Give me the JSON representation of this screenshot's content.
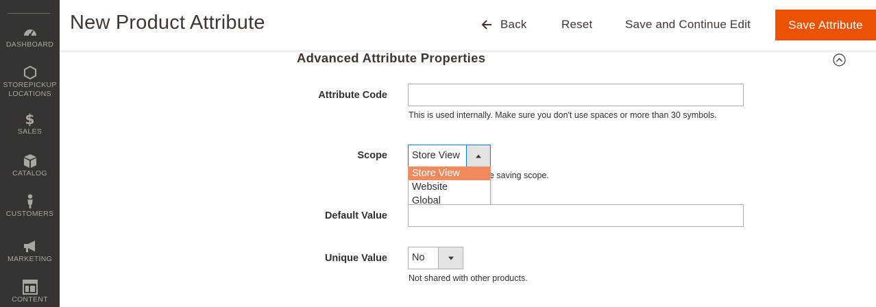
{
  "sidebar": {
    "items": [
      {
        "label": "DASHBOARD",
        "icon": "dashboard-icon"
      },
      {
        "label_line1": "STOREPICKUP",
        "label_line2": "LOCATIONS",
        "icon": "hexagon-icon"
      },
      {
        "label": "SALES",
        "icon": "dollar-icon",
        "glyph": "$"
      },
      {
        "label": "CATALOG",
        "icon": "catalog-box-icon"
      },
      {
        "label": "CUSTOMERS",
        "icon": "customer-person-icon"
      },
      {
        "label": "MARKETING",
        "icon": "megaphone-icon"
      },
      {
        "label": "CONTENT",
        "icon": "content-layout-icon"
      }
    ]
  },
  "header": {
    "title": "New Product Attribute",
    "back_label": "Back",
    "reset_label": "Reset",
    "save_continue_label": "Save and Continue Edit",
    "save_attribute_label": "Save Attribute"
  },
  "section": {
    "title": "Advanced Attribute Properties"
  },
  "fields": {
    "attribute_code": {
      "label": "Attribute Code",
      "value": "",
      "note": "This is used internally. Make sure you don't use spaces or more than 30 symbols."
    },
    "scope": {
      "label": "Scope",
      "value": "Store View",
      "note_visible": "e saving scope.",
      "options": [
        "Store View",
        "Website",
        "Global"
      ],
      "selected_index": 0
    },
    "default_value": {
      "label": "Default Value",
      "value": ""
    },
    "unique_value": {
      "label": "Unique Value",
      "value": "No",
      "note": "Not shared with other products."
    }
  },
  "colors": {
    "sidebar_bg": "#373330",
    "accent": "#eb5202",
    "selected_option": "#f38a5e",
    "focus_border": "#007bdb"
  }
}
